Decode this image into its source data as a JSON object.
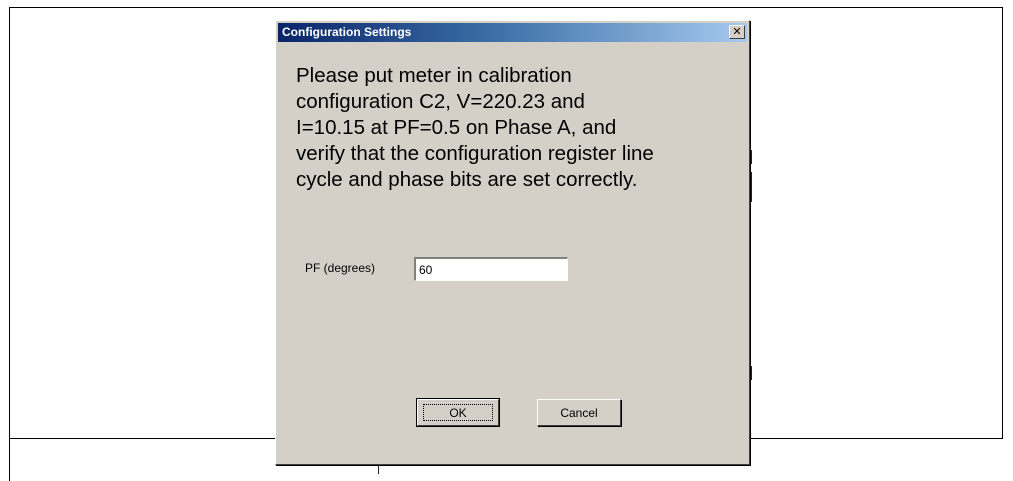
{
  "dialog": {
    "title": "Configuration Settings",
    "close_glyph": "✕",
    "message_lines": [
      "Please put meter in calibration",
      "configuration C2, V=220.23 and",
      "I=10.15 at PF=0.5 on Phase A, and",
      "verify that the configuration register line",
      "cycle and phase bits are set correctly."
    ],
    "field": {
      "label": "PF (degrees)",
      "value": "60"
    },
    "buttons": {
      "ok": "OK",
      "cancel": "Cancel"
    }
  },
  "colors": {
    "dialog_face": "#d4d0c8",
    "titlebar_start": "#0a246a",
    "titlebar_end": "#a6caf0"
  }
}
